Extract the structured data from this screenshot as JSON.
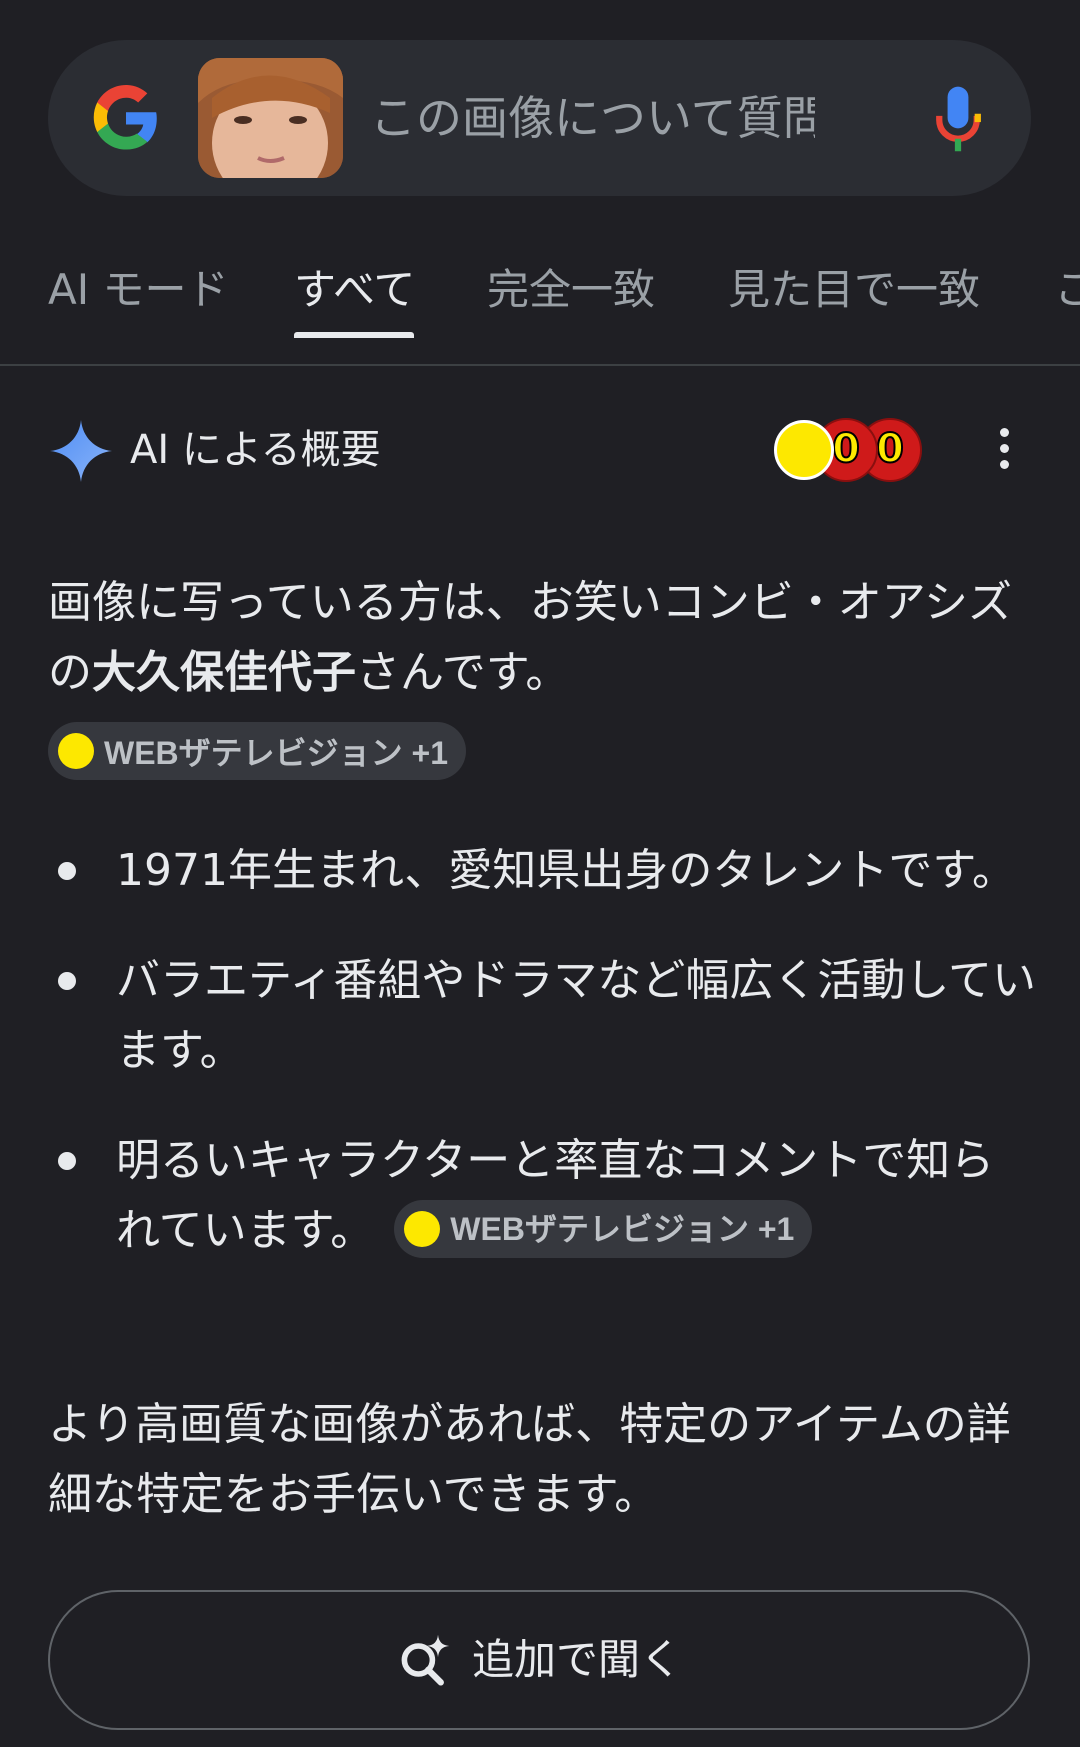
{
  "search": {
    "placeholder": "この画像について質問す",
    "logo": "google-g-logo",
    "mic_icon": "microphone-icon"
  },
  "tabs": [
    {
      "label": "AI モード",
      "active": false
    },
    {
      "label": "すべて",
      "active": true
    },
    {
      "label": "完全一致",
      "active": false
    },
    {
      "label": "見た目で一致",
      "active": false
    },
    {
      "label": "こ",
      "active": false
    }
  ],
  "ai_overview": {
    "title": "AI による概要",
    "coin_digits": [
      "0",
      "0"
    ],
    "intro_before": "画像に写っている方は、お笑いコンビ・オアシズの",
    "intro_name": "大久保佳代子",
    "intro_after": "さんです。",
    "source_chip": "WEBザテレビジョン +1",
    "bullets": [
      {
        "text": "1971年生まれ、愛知県出身のタレントです。"
      },
      {
        "text": "バラエティ番組やドラマなど幅広く活動しています。"
      },
      {
        "text": "明るいキャラクターと率直なコメントで知られています。",
        "chip": "WEBザテレビジョン +1"
      }
    ],
    "outro": "より高画質な画像があれば、特定のアイテムの詳細な特定をお手伝いできます。",
    "ask_button": "追加で聞く"
  },
  "colors": {
    "background": "#1f1f24",
    "searchbar": "#2b2d33",
    "chip": "#36383e",
    "coin_yellow": "#fde800",
    "coin_red": "#cf1a1a"
  }
}
